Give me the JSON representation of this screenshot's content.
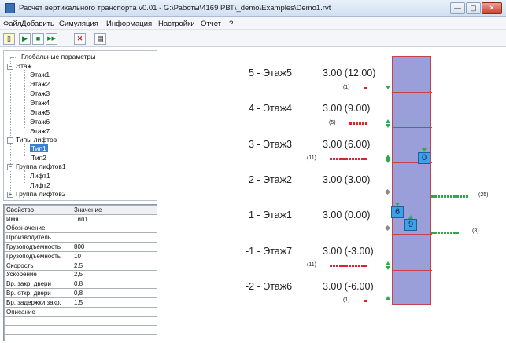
{
  "window": {
    "title": "Расчет вертикального транспорта v0.01 - G:\\Работы\\4169 РВТ\\_demo\\Examples\\Demo1.rvt"
  },
  "menu": [
    "Файл",
    "Добавить",
    "Симуляция",
    "Информация",
    "Настройки",
    "Отчет",
    "?"
  ],
  "toolbar": {
    "new_icon": "new-doc-icon",
    "play_icon": "▶",
    "stop_icon": "■",
    "step_icon": "▶▶",
    "cancel_icon": "✕",
    "report_icon": "report-icon"
  },
  "tree": {
    "global": "Глобальные параметры",
    "floors_label": "Этаж",
    "floors": [
      "Этаж1",
      "Этаж2",
      "Этаж3",
      "Этаж4",
      "Этаж5",
      "Этаж6",
      "Этаж7"
    ],
    "types_label": "Типы лифтов",
    "types": [
      "Тип1",
      "Тип2"
    ],
    "group1_label": "Группа лифтов1",
    "group1": [
      "Лифт1",
      "Лифт2"
    ],
    "group2_label": "Группа лифтов2"
  },
  "props": {
    "headers": [
      "Свойство",
      "Значение"
    ],
    "rows": [
      [
        "Имя",
        "Тип1"
      ],
      [
        "Обозначение",
        ""
      ],
      [
        "Производитель",
        ""
      ],
      [
        "Грузоподъемность",
        "800"
      ],
      [
        "Грузоподъемность",
        "10"
      ],
      [
        "Скорость",
        "2,5"
      ],
      [
        "Ускорение",
        "2,5"
      ],
      [
        "Вр. закр. двери",
        "0,8"
      ],
      [
        "Вр. откр. двери",
        "0,8"
      ],
      [
        "Вр. задержки закр.",
        "1,5"
      ],
      [
        "Описание",
        ""
      ],
      [
        "",
        ""
      ],
      [
        "",
        ""
      ],
      [
        "",
        ""
      ]
    ]
  },
  "floors": [
    {
      "label": "5 - Этаж5",
      "height": "3.00 (12.00)",
      "count": "(1)",
      "queue": 1
    },
    {
      "label": "4 - Этаж4",
      "height": "3.00 (9.00)",
      "count": "(5)",
      "queue": 5
    },
    {
      "label": "3 - Этаж3",
      "height": "3.00 (6.00)",
      "count": "(11)",
      "queue": 11
    },
    {
      "label": "2 - Этаж2",
      "height": "3.00 (3.00)",
      "count": "",
      "queue": 0
    },
    {
      "label": "1 - Этаж1",
      "height": "3.00 (0.00)",
      "count": "",
      "queue": 0
    },
    {
      "label": "-1 - Этаж7",
      "height": "3.00 (-3.00)",
      "count": "(11)",
      "queue": 11
    },
    {
      "label": "-2 - Этаж6",
      "height": "3.00 (-6.00)",
      "count": "(1)",
      "queue": 1
    }
  ],
  "shaft_counts": [
    {
      "count": "(25)",
      "floor": "2 - Этаж2"
    },
    {
      "count": "(8)",
      "floor": "1 - Этаж1"
    }
  ],
  "cars": [
    "0",
    "6",
    "9"
  ],
  "colors": {
    "shaft": "#9b9fd9",
    "car": "#3fa0e6",
    "queue_waiting": "#d9262c",
    "queue_exiting": "#2eaa4a",
    "selection": "#3d7fd6"
  }
}
